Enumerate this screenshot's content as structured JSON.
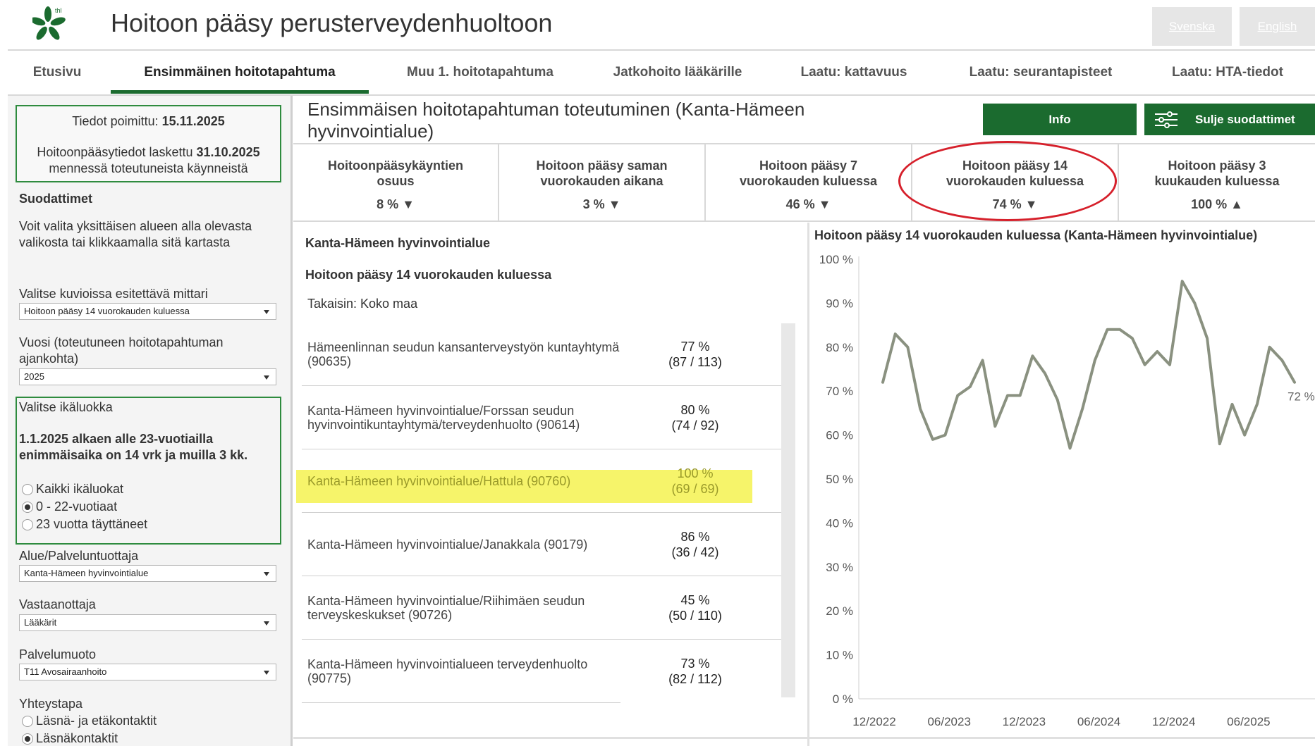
{
  "header": {
    "logo_text": "thl",
    "title": "Hoitoon pääsy perusterveydenhuoltoon",
    "lang_sv": "Svenska",
    "lang_en": "English"
  },
  "tabs": [
    {
      "label": "Etusivu"
    },
    {
      "label": "Ensimmäinen hoitotapahtuma"
    },
    {
      "label": "Muu 1. hoitotapahtuma"
    },
    {
      "label": "Jatkohoito lääkärille"
    },
    {
      "label": "Laatu: kattavuus"
    },
    {
      "label": "Laatu: seurantapisteet"
    },
    {
      "label": "Laatu: HTA-tiedot"
    }
  ],
  "sidebar": {
    "fetched_label": "Tiedot poimittu:",
    "fetched_date": "15.11.2025",
    "calc_label": "Hoitoonpääsytiedot laskettu",
    "calc_date": "31.10.2025",
    "calc_suffix": "mennessä toteutuneista käynneistä",
    "filters_heading": "Suodattimet",
    "filters_help": "Voit valita yksittäisen alueen alla olevasta valikosta tai klikkaamalla sitä kartasta",
    "metric_label": "Valitse kuvioissa esitettävä mittari",
    "metric_value": "Hoitoon pääsy 14 vuorokauden kuluessa",
    "year_label": "Vuosi (toteutuneen hoitotapahtuman ajankohta)",
    "year_value": "2025",
    "age_label": "Valitse ikäluokka",
    "age_note": "1.1.2025 alkaen alle 23-vuotiailla enimmäisaika on 14 vrk ja muilla 3 kk.",
    "age_options": [
      "Kaikki ikäluokat",
      "0 - 22-vuotiaat",
      "23 vuotta täyttäneet"
    ],
    "age_selected": "0 - 22-vuotiaat",
    "area_label": "Alue/Palveluntuottaja",
    "area_value": "Kanta-Hämeen hyvinvointialue",
    "receiver_label": "Vastaanottaja",
    "receiver_value": "Lääkärit",
    "service_label": "Palvelumuoto",
    "service_value": "T11 Avosairaanhoito",
    "contact_label": "Yhteystapa",
    "contact_options": [
      "Läsnä- ja etäkontaktit",
      "Läsnäkontaktit"
    ],
    "contact_selected": "Läsnäkontaktit"
  },
  "main": {
    "title": "Ensimmäisen hoitotapahtuman toteutuminen (Kanta-Hämeen hyvinvointialue)",
    "info_button": "Info",
    "filters_button": "Sulje suodattimet"
  },
  "kpis": [
    {
      "label": "Hoitoonpääsykäyntien osuus",
      "value": "8 % ▼",
      "trend": "down"
    },
    {
      "label": "Hoitoon pääsy saman vuorokauden aikana",
      "value": "3 % ▼",
      "trend": "down"
    },
    {
      "label": "Hoitoon pääsy 7 vuorokauden kuluessa",
      "value": "46 % ▼",
      "trend": "down"
    },
    {
      "label": "Hoitoon pääsy 14 vuorokauden kuluessa",
      "value": "74 % ▼",
      "trend": "down",
      "circled": true
    },
    {
      "label": "Hoitoon pääsy 3 kuukauden kuluessa",
      "value": "100 % ▲",
      "trend": "up"
    }
  ],
  "list": {
    "area": "Kanta-Hämeen hyvinvointialue",
    "metric": "Hoitoon pääsy 14 vuorokauden kuluessa",
    "back": "Takaisin: Koko maa",
    "rows": [
      {
        "name": "Hämeenlinnan seudun kansanterveystyön kuntayhtymä (90635)",
        "pct": "77 %",
        "count": "(87 / 113)"
      },
      {
        "name": "Kanta-Hämeen hyvinvointialue/Forssan seudun hyvinvointikuntayhtymä/terveydenhuolto (90614)",
        "pct": "80 %",
        "count": "(74 / 92)"
      },
      {
        "name": "Kanta-Hämeen hyvinvointialue/Hattula (90760)",
        "pct": "100 %",
        "count": "(69 / 69)",
        "highlighted": true
      },
      {
        "name": "Kanta-Hämeen hyvinvointialue/Janakkala (90179)",
        "pct": "86 %",
        "count": "(36 / 42)"
      },
      {
        "name": "Kanta-Hämeen hyvinvointialue/Riihimäen seudun terveyskeskukset (90726)",
        "pct": "45 %",
        "count": "(50 / 110)"
      },
      {
        "name": "Kanta-Hämeen hyvinvointialueen terveydenhuolto (90775)",
        "pct": "73 %",
        "count": "(82 / 112)"
      }
    ]
  },
  "colors": {
    "brand_green": "#1b6b2f",
    "frame_green": "#2e8b3e",
    "line": "#8a9180",
    "circle_red": "#d6202b",
    "highlight": "#f6f46a"
  },
  "chart_data": {
    "type": "line",
    "title": "Hoitoon pääsy 14 vuorokauden kuluessa (Kanta-Hämeen hyvinvointialue)",
    "ylim": [
      0,
      100
    ],
    "y_ticks": [
      "0 %",
      "10 %",
      "20 %",
      "30 %",
      "40 %",
      "50 %",
      "60 %",
      "70 %",
      "80 %",
      "90 %",
      "100 %"
    ],
    "x_ticks": [
      "12/2022",
      "06/2023",
      "12/2023",
      "06/2024",
      "12/2024",
      "06/2025"
    ],
    "end_label": "72 %",
    "series": [
      {
        "values": [
          72,
          83,
          80,
          66,
          59,
          60,
          69,
          71,
          77,
          62,
          69,
          69,
          78,
          74,
          68,
          57,
          66,
          77,
          84,
          84,
          82,
          76,
          79,
          76,
          95,
          90,
          82,
          58,
          67,
          60,
          67,
          80,
          77,
          72
        ]
      }
    ]
  }
}
